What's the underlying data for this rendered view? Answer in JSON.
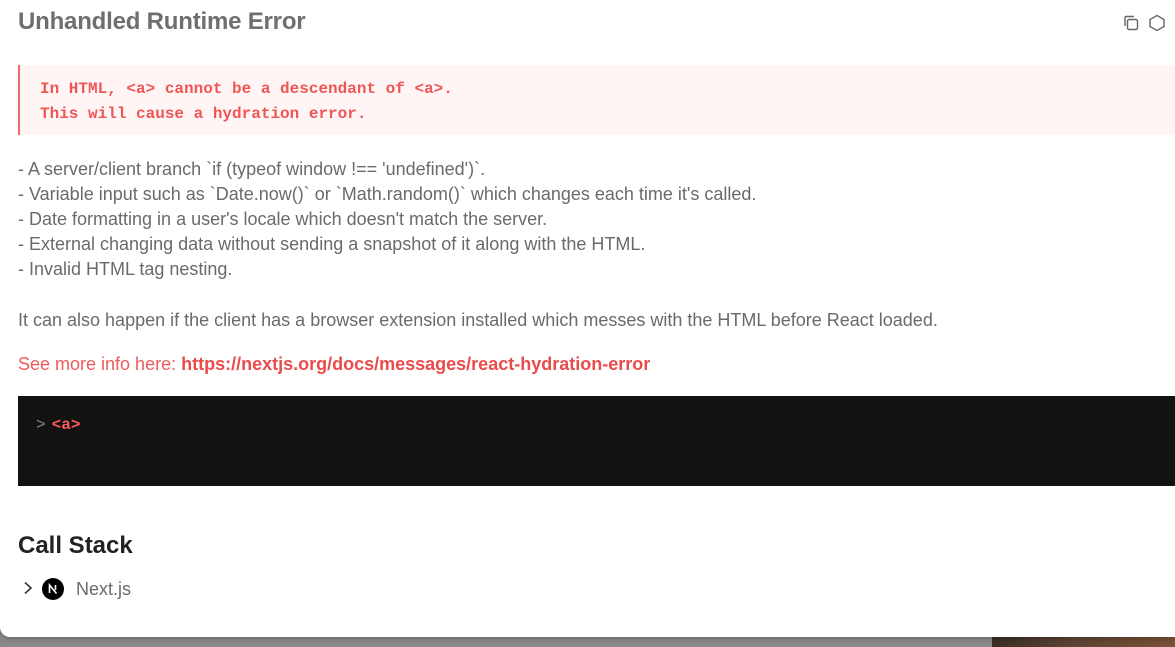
{
  "dialog": {
    "title": "Unhandled Runtime Error",
    "actions": [
      {
        "name": "copy-icon"
      },
      {
        "name": "nextjs-docs-icon"
      }
    ]
  },
  "error_message": {
    "lines": [
      "In HTML, <a> cannot be a descendant of <a>.",
      "This will cause a hydration error."
    ]
  },
  "causes": [
    "- A server/client branch `if (typeof window !== 'undefined')`.",
    "- Variable input such as `Date.now()` or `Math.random()` which changes each time it's called.",
    "- Date formatting in a user's locale which doesn't match the server.",
    "- External changing data without sending a snapshot of it along with the HTML.",
    "- Invalid HTML tag nesting."
  ],
  "extension_note": "It can also happen if the client has a browser extension installed which messes with the HTML before React loaded.",
  "more_info": {
    "prefix": "See more info here: ",
    "link_text": "https://nextjs.org/docs/messages/react-hydration-error"
  },
  "code_frame": {
    "chevron": ">",
    "text": "<a>"
  },
  "call_stack": {
    "heading": "Call Stack",
    "frames": [
      {
        "label": "Next.js",
        "icon": "nextjs-logo-icon",
        "expand_icon": "chevron-right-icon"
      }
    ]
  },
  "colors": {
    "error_text": "#ef5656",
    "error_bg": "#fff5f5",
    "code_bg": "#121212",
    "link": "#ea4b4b"
  }
}
